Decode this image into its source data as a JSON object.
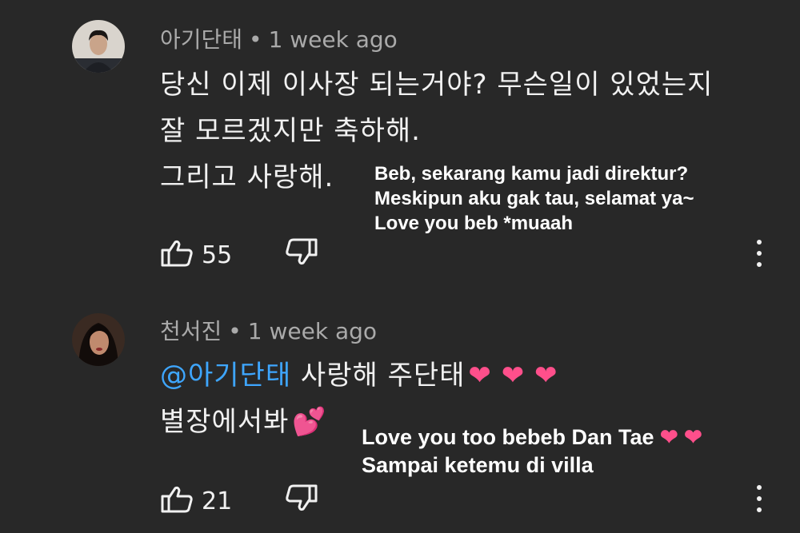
{
  "comments": [
    {
      "author": "아기단태",
      "separator": "•",
      "time": "1 week ago",
      "lines": [
        "당신 이제 이사장 되는거야? 무슨일이 있었는지",
        "잘 모르겠지만 축하해.",
        "그리고 사랑해."
      ],
      "likes": "55",
      "avatar": "avatar-man"
    },
    {
      "author": "천서진",
      "separator": "•",
      "time": "1 week ago",
      "mention": "@아기단태",
      "line1_text": " 사랑해 주단태",
      "line1_emoji": "❤ ❤ ❤",
      "line2_text": "별장에서봐",
      "line2_emoji": "💕",
      "likes": "21",
      "avatar": "avatar-woman"
    }
  ],
  "overlays": {
    "first": [
      "Beb, sekarang kamu jadi direktur?",
      "Meskipun aku gak tau, selamat ya~",
      "Love you beb *muaah"
    ],
    "second_line1": "Love you too bebeb  Dan Tae ",
    "second_line1_emoji": "❤ ❤",
    "second_line2": "Sampai ketemu di villa"
  },
  "icons": [
    "thumbs-up-icon",
    "thumbs-down-icon",
    "more-vert-icon"
  ],
  "colors": {
    "background": "#282828",
    "text": "#f1f1f1",
    "meta": "#aaaaaa",
    "mention": "#3ea6ff",
    "heart": "#ff4f8b"
  }
}
